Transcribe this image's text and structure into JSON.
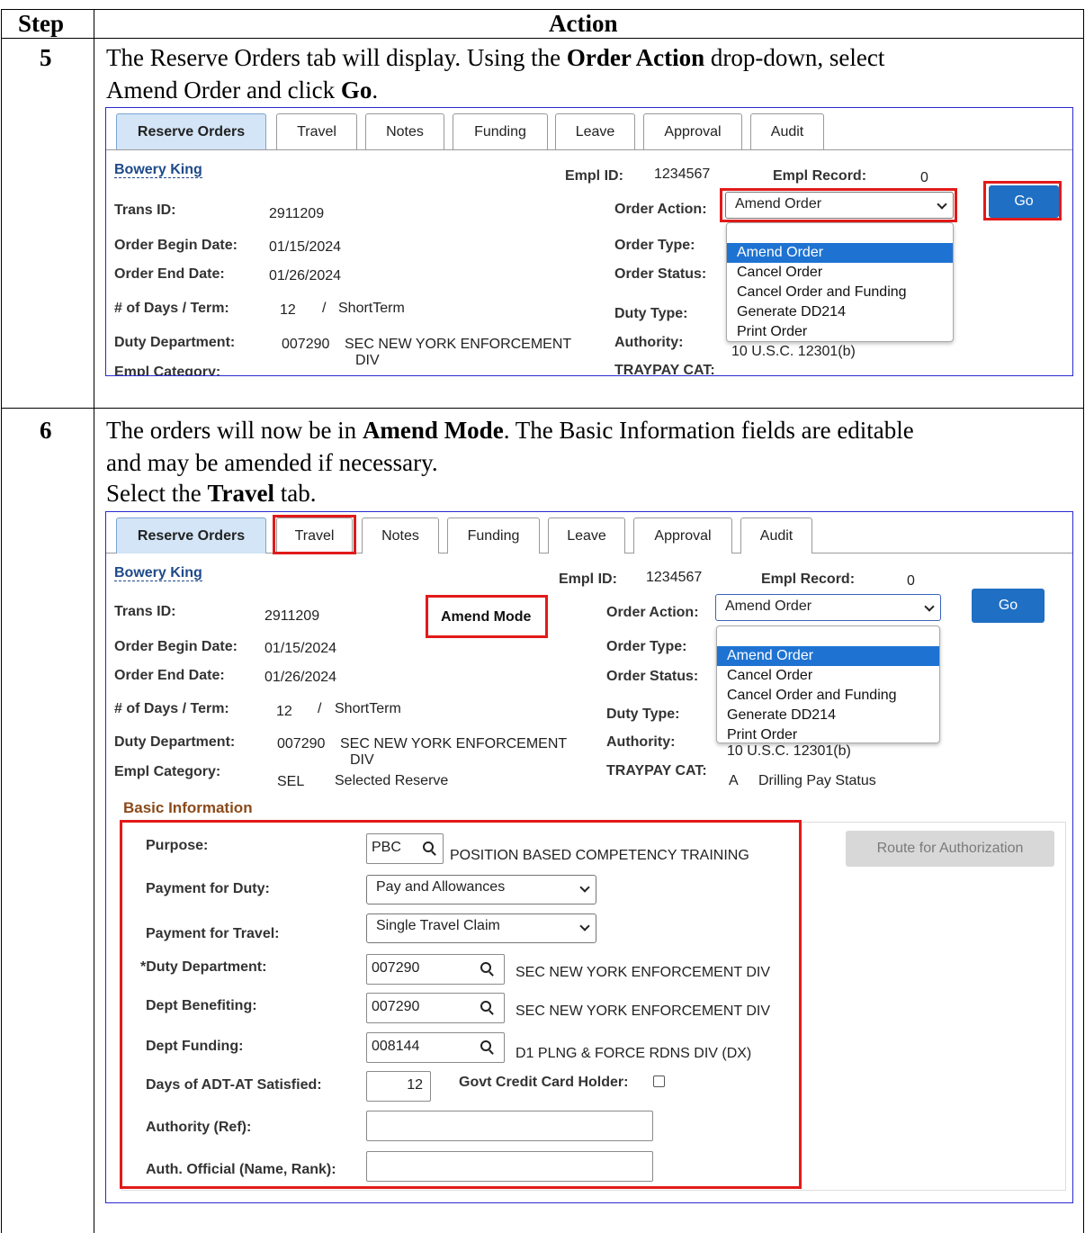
{
  "table": {
    "header_step": "Step",
    "header_action": "Action"
  },
  "step5": {
    "number": "5",
    "line1_pre": "The Reserve Orders tab will display. Using the ",
    "line1_bold": "Order Action",
    "line1_post": " drop-down, select",
    "line2_pre": "Amend Order and click ",
    "line2_bold": "Go",
    "line2_post": "."
  },
  "step6": {
    "number": "6",
    "line1_pre": "The orders will now be in ",
    "line1_bold": "Amend Mode",
    "line1_post": ". The Basic Information fields are editable",
    "line2": "and may be amended if necessary.",
    "line3_pre": "Select the ",
    "line3_bold": "Travel",
    "line3_post": " tab."
  },
  "tabs": [
    "Reserve Orders",
    "Travel",
    "Notes",
    "Funding",
    "Leave",
    "Approval",
    "Audit"
  ],
  "employee": {
    "name": "Bowery King",
    "empl_id_label": "Empl ID:",
    "empl_id": "1234567",
    "empl_record_label": "Empl Record:",
    "empl_record": "0",
    "trans_id_label": "Trans ID:",
    "trans_id": "2911209",
    "order_action_label": "Order Action:",
    "order_action": "Amend Order",
    "go_label": "Go",
    "begin_label": "Order Begin Date:",
    "begin_date": "01/15/2024",
    "end_label": "Order End Date:",
    "end_date": "01/26/2024",
    "order_type_label": "Order Type:",
    "order_status_label": "Order Status:",
    "days_label": "# of Days / Term:",
    "days": "12",
    "slash": "/",
    "term": "ShortTerm",
    "duty_type_label": "Duty Type:",
    "duty_dept_label": "Duty Department:",
    "duty_dept_code": "007290",
    "duty_dept_name": "SEC NEW YORK ENFORCEMENT",
    "duty_dept_name2": "DIV",
    "authority_label": "Authority:",
    "authority_partial": "10 U.S.C. 12301(b)",
    "empl_cat_label": "Empl Category:",
    "empl_cat_code": "SEL",
    "empl_cat_name": "Selected Reserve",
    "traypay_label": "TRAYPAY CAT:",
    "traypay_code": "A",
    "traypay_name": "Drilling Pay Status",
    "amend_mode": "Amend Mode"
  },
  "dropdown_options": [
    "Amend Order",
    "Cancel Order",
    "Cancel Order and Funding",
    "Generate DD214",
    "Print Order"
  ],
  "basic_info": {
    "title": "Basic Information",
    "purpose_label": "Purpose:",
    "purpose_code": "PBC",
    "purpose_desc": "POSITION BASED COMPETENCY TRAINING",
    "route_label": "Route for Authorization",
    "pay_duty_label": "Payment for Duty:",
    "pay_duty_value": "Pay and Allowances",
    "pay_travel_label": "Payment for Travel:",
    "pay_travel_value": "Single Travel Claim",
    "duty_dept_label": "*Duty Department:",
    "duty_dept_code": "007290",
    "duty_dept_desc": "SEC NEW YORK ENFORCEMENT DIV",
    "dept_ben_label": "Dept Benefiting:",
    "dept_ben_code": "007290",
    "dept_ben_desc": "SEC NEW YORK ENFORCEMENT DIV",
    "dept_fund_label": "Dept Funding:",
    "dept_fund_code": "008144",
    "dept_fund_desc": "D1 PLNG & FORCE RDNS DIV (DX)",
    "days_adt_label": "Days of ADT-AT Satisfied:",
    "days_adt_value": "12",
    "gcc_label": "Govt Credit Card Holder:",
    "authority_ref_label": "Authority (Ref):",
    "authority_ref_value": "",
    "auth_official_label": "Auth. Official (Name, Rank):",
    "auth_official_value": ""
  }
}
